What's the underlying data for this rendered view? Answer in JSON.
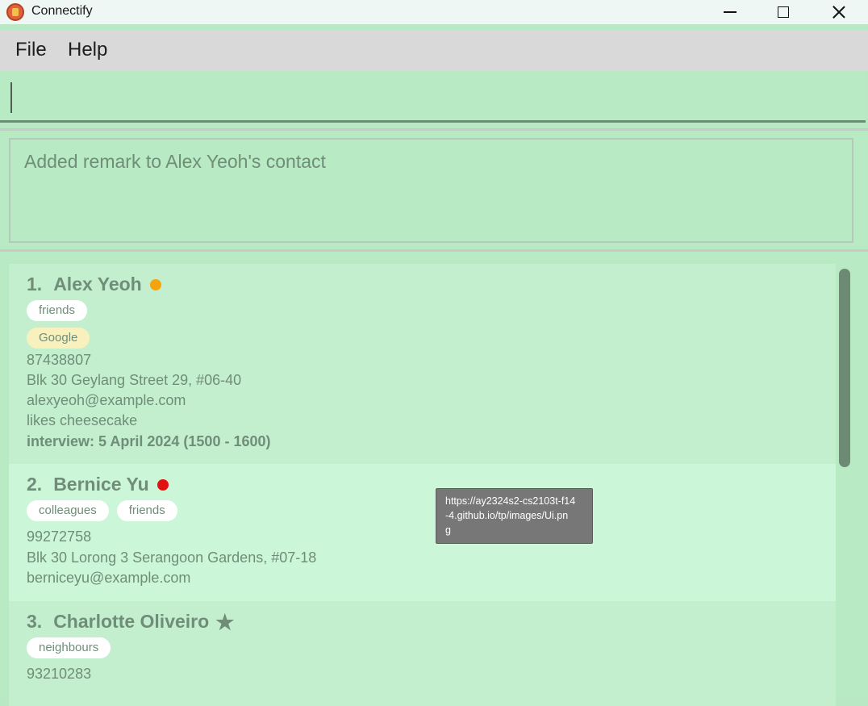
{
  "window": {
    "title": "Connectify"
  },
  "menu": {
    "items": [
      "File",
      "Help"
    ]
  },
  "command": {
    "value": ""
  },
  "result": {
    "message": "Added remark to Alex Yeoh's contact"
  },
  "persons": [
    {
      "index": "1.",
      "name": "Alex Yeoh",
      "status_icon": "orange-dot",
      "status_color": "#f5a30f",
      "tags": [
        "friends"
      ],
      "company_tags": [
        "Google"
      ],
      "phone": "87438807",
      "address": "Blk 30 Geylang Street 29, #06-40",
      "email": "alexyeoh@example.com",
      "remark": "likes cheesecake",
      "interview": "interview: 5 April 2024 (1500 - 1600)"
    },
    {
      "index": "2.",
      "name": "Bernice Yu",
      "status_icon": "red-dot",
      "status_color": "#e31212",
      "tags": [
        "colleagues",
        "friends"
      ],
      "phone": "99272758",
      "address": "Blk 30 Lorong 3 Serangoon Gardens, #07-18",
      "email": "berniceyu@example.com"
    },
    {
      "index": "3.",
      "name": "Charlotte Oliveiro",
      "status_icon": "star-icon",
      "tags": [
        "neighbours"
      ],
      "phone": "93210283"
    }
  ],
  "tooltip": {
    "lines": [
      "https://ay2324s2-cs2103t-f14",
      "-4.github.io/tp/images/Ui.pn",
      "g"
    ]
  }
}
